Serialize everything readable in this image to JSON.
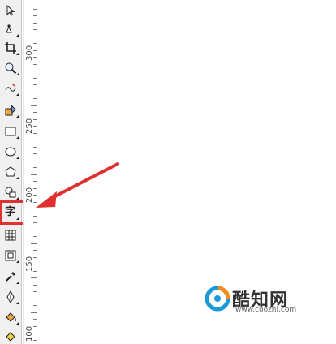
{
  "toolbox": {
    "items": [
      {
        "icon": "pick-tool-icon"
      },
      {
        "icon": "shape-tool-icon"
      },
      {
        "icon": "crop-tool-icon"
      },
      {
        "icon": "zoom-tool-icon"
      },
      {
        "icon": "freehand-tool-icon"
      },
      {
        "icon": "smart-fill-tool-icon"
      },
      {
        "icon": "rectangle-tool-icon"
      },
      {
        "icon": "ellipse-tool-icon"
      },
      {
        "icon": "polygon-tool-icon"
      },
      {
        "icon": "basic-shapes-tool-icon"
      },
      {
        "icon": "text-tool-icon",
        "label": "字",
        "highlighted": true
      },
      {
        "icon": "table-tool-icon"
      },
      {
        "icon": "contour-tool-icon"
      },
      {
        "icon": "eyedropper-tool-icon"
      },
      {
        "icon": "outline-pen-tool-icon"
      },
      {
        "icon": "fill-tool-icon"
      },
      {
        "icon": "interactive-fill-tool-icon"
      }
    ],
    "highlight_color": "#e03030"
  },
  "ruler": {
    "labels": [
      "300",
      "250",
      "200",
      "150",
      "100"
    ]
  },
  "annotation": {
    "arrow_color": "#e03030"
  },
  "watermark": {
    "name": "酷知网",
    "url": "www.coozhi.com",
    "logo_colors": [
      "#1a9ad6",
      "#f28c1e"
    ]
  }
}
